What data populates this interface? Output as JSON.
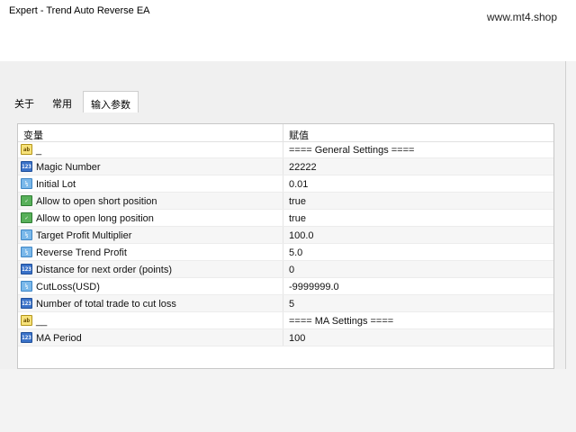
{
  "window": {
    "title": "Expert - Trend Auto Reverse EA"
  },
  "watermark": "www.mt4.shop",
  "tabs": [
    {
      "label": "关于"
    },
    {
      "label": "常用"
    },
    {
      "label": "输入参数"
    }
  ],
  "grid": {
    "headers": {
      "variable": "变量",
      "value": "赋值"
    },
    "rows": [
      {
        "icon": "ab",
        "name": "_",
        "value": "==== General Settings ===="
      },
      {
        "icon": "int",
        "name": "Magic Number",
        "value": "22222"
      },
      {
        "icon": "dbl",
        "name": "Initial Lot",
        "value": "0.01"
      },
      {
        "icon": "bool",
        "name": "Allow to open short position",
        "value": "true"
      },
      {
        "icon": "bool",
        "name": "Allow to open long position",
        "value": "true"
      },
      {
        "icon": "dbl",
        "name": "Target Profit Multiplier",
        "value": "100.0"
      },
      {
        "icon": "dbl",
        "name": "Reverse Trend Profit",
        "value": "5.0"
      },
      {
        "icon": "int",
        "name": "Distance for next order (points)",
        "value": "0"
      },
      {
        "icon": "dbl",
        "name": "CutLoss(USD)",
        "value": "-9999999.0"
      },
      {
        "icon": "int",
        "name": "Number of total trade to cut loss",
        "value": "5"
      },
      {
        "icon": "ab",
        "name": "__",
        "value": "==== MA Settings ===="
      },
      {
        "icon": "int",
        "name": "MA Period",
        "value": "100"
      }
    ]
  }
}
